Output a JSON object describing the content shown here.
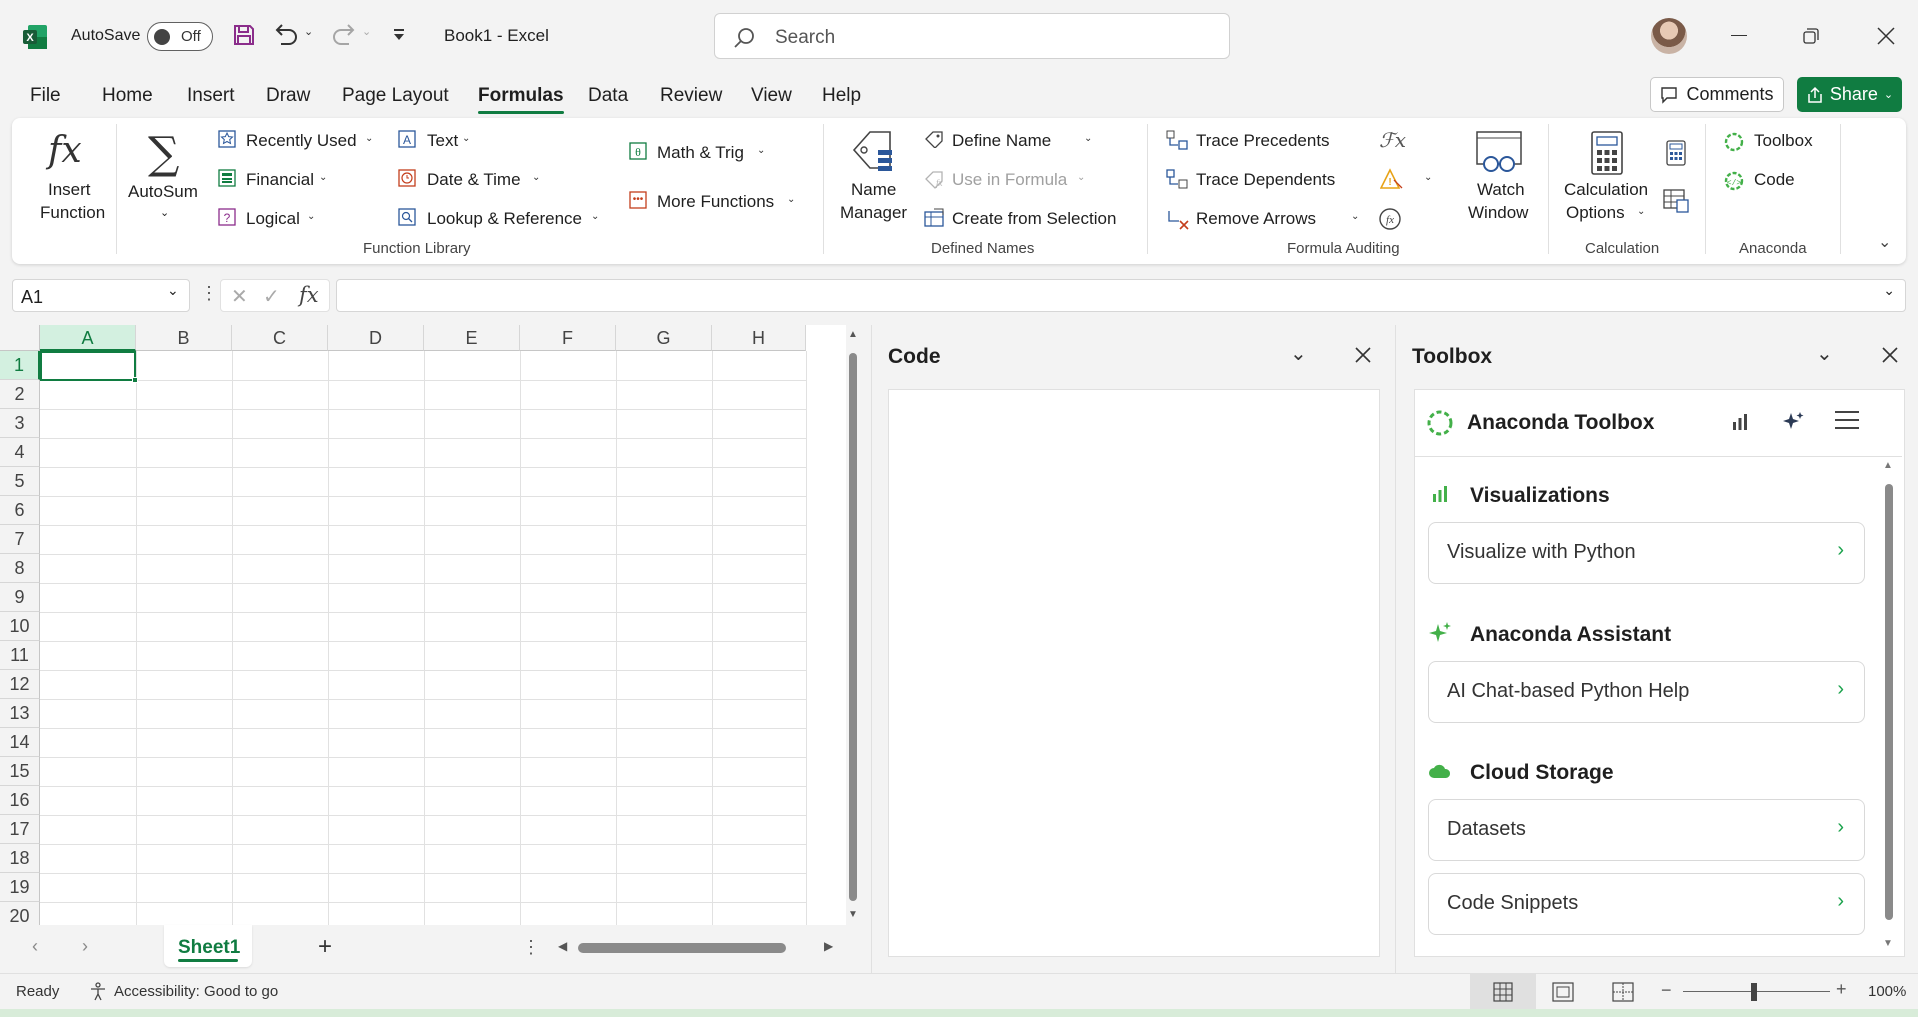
{
  "titlebar": {
    "autosave_label": "AutoSave",
    "autosave_state": "Off",
    "doc_title": "Book1  -  Excel",
    "search_placeholder": "Search"
  },
  "tabs": [
    "File",
    "Home",
    "Insert",
    "Draw",
    "Page Layout",
    "Formulas",
    "Data",
    "Review",
    "View",
    "Help"
  ],
  "active_tab": "Formulas",
  "actions": {
    "comments": "Comments",
    "share": "Share"
  },
  "ribbon": {
    "function_library": {
      "insert_function": [
        "Insert",
        "Function"
      ],
      "autosum": "AutoSum",
      "recently_used": "Recently Used",
      "financial": "Financial",
      "logical": "Logical",
      "text": "Text",
      "date_time": "Date & Time",
      "lookup_reference": "Lookup & Reference",
      "math_trig": "Math & Trig",
      "more_functions": "More Functions",
      "group_label": "Function Library"
    },
    "defined_names": {
      "name_manager": [
        "Name",
        "Manager"
      ],
      "define_name": "Define Name",
      "use_in_formula": "Use in Formula",
      "create_from_selection": "Create from Selection",
      "group_label": "Defined Names"
    },
    "formula_auditing": {
      "trace_precedents": "Trace Precedents",
      "trace_dependents": "Trace Dependents",
      "remove_arrows": "Remove Arrows",
      "watch_window": [
        "Watch",
        "Window"
      ],
      "group_label": "Formula Auditing"
    },
    "calculation": {
      "calculation_options": [
        "Calculation",
        "Options"
      ],
      "group_label": "Calculation"
    },
    "anaconda": {
      "toolbox": "Toolbox",
      "code": "Code",
      "group_label": "Anaconda"
    }
  },
  "formula_bar": {
    "name_box": "A1",
    "fx": "fx",
    "content": ""
  },
  "grid": {
    "columns": [
      "A",
      "B",
      "C",
      "D",
      "E",
      "F",
      "G",
      "H"
    ],
    "rows": [
      "1",
      "2",
      "3",
      "4",
      "5",
      "6",
      "7",
      "8",
      "9",
      "10",
      "11",
      "12",
      "13",
      "14",
      "15",
      "16",
      "17",
      "18",
      "19",
      "20"
    ],
    "selected_cell": "A1"
  },
  "sheets": {
    "active": "Sheet1"
  },
  "code_pane": {
    "title": "Code"
  },
  "toolbox_pane": {
    "title": "Toolbox",
    "header": "Anaconda Toolbox",
    "sections": [
      {
        "title": "Visualizations",
        "items": [
          "Visualize with Python"
        ]
      },
      {
        "title": "Anaconda Assistant",
        "items": [
          "AI Chat-based Python Help"
        ]
      },
      {
        "title": "Cloud Storage",
        "items": [
          "Datasets",
          "Code Snippets"
        ]
      }
    ]
  },
  "status": {
    "ready": "Ready",
    "accessibility": "Accessibility: Good to go",
    "zoom": "100%"
  },
  "colors": {
    "excel_green": "#107c41",
    "anaconda_green": "#43b049",
    "selection": "#107c41"
  }
}
